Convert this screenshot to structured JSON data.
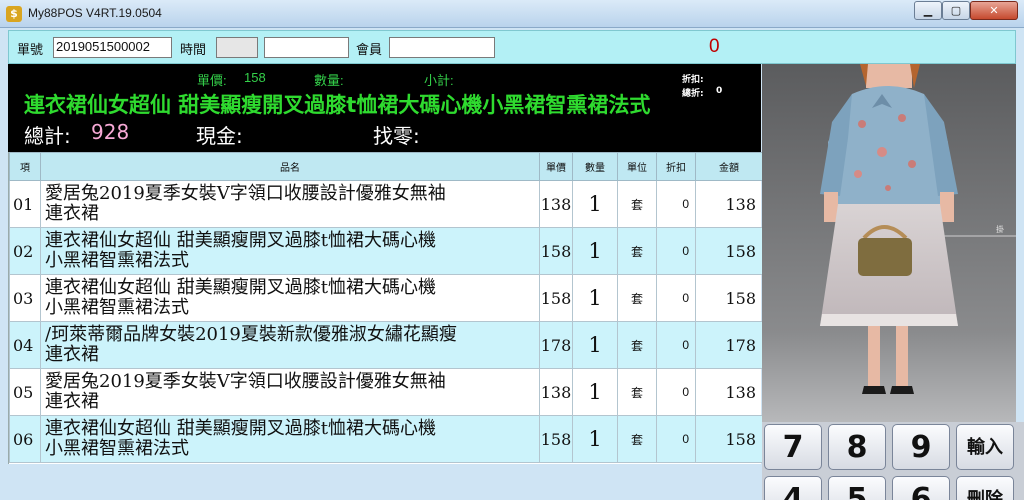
{
  "window": {
    "title": "My88POS V4RT.19.0504",
    "app_icon_glyph": "$",
    "minimize_glyph": "▁",
    "maximize_glyph": "▢",
    "close_glyph": "✕"
  },
  "header": {
    "order_label": "單號",
    "order_value": "2019051500002",
    "time_label": "時間",
    "time_value": "",
    "time_value2": "",
    "member_label": "會員",
    "member_value": "",
    "counter": "0"
  },
  "info": {
    "unit_price_label": "單價:",
    "unit_price_value": "158",
    "qty_label": "數量:",
    "subtotal_label": "小計:",
    "discount_label": "折扣:",
    "total_discount_label": "總折:",
    "total_discount_value": "0",
    "product_name": "連衣裙仙女超仙 甜美顯瘦開叉過膝t恤裙大碼心機小黑裙智熏裙法式",
    "total_label": "總計:",
    "total_value": "928",
    "cash_label": "現金:",
    "change_label": "找零:"
  },
  "table": {
    "columns": [
      "項",
      "品名",
      "單價",
      "數量",
      "單位",
      "折扣",
      "金額"
    ],
    "rows": [
      {
        "no": "01",
        "name": "愛居兔2019夏季女裝V字領口收腰設計優雅女無袖\n連衣裙",
        "price": "138",
        "qty": "1",
        "unit": "套",
        "discount": "0",
        "amount": "138"
      },
      {
        "no": "02",
        "name": "連衣裙仙女超仙 甜美顯瘦開叉過膝t恤裙大碼心機\n小黑裙智熏裙法式",
        "price": "158",
        "qty": "1",
        "unit": "套",
        "discount": "0",
        "amount": "158"
      },
      {
        "no": "03",
        "name": "連衣裙仙女超仙 甜美顯瘦開叉過膝t恤裙大碼心機\n小黑裙智熏裙法式",
        "price": "158",
        "qty": "1",
        "unit": "套",
        "discount": "0",
        "amount": "158"
      },
      {
        "no": "04",
        "name": "/珂萊蒂爾品牌女裝2019夏裝新款優雅淑女繡花顯瘦\n連衣裙",
        "price": "178",
        "qty": "1",
        "unit": "套",
        "discount": "0",
        "amount": "178"
      },
      {
        "no": "05",
        "name": "愛居兔2019夏季女裝V字領口收腰設計優雅女無袖\n連衣裙",
        "price": "138",
        "qty": "1",
        "unit": "套",
        "discount": "0",
        "amount": "138"
      },
      {
        "no": "06",
        "name": "連衣裙仙女超仙 甜美顯瘦開叉過膝t恤裙大碼心機\n小黑裙智熏裙法式",
        "price": "158",
        "qty": "1",
        "unit": "套",
        "discount": "0",
        "amount": "158"
      }
    ]
  },
  "photo": {
    "side_label": "掛"
  },
  "keypad": {
    "keys": [
      "7",
      "8",
      "9",
      "輸入",
      "4",
      "5",
      "6",
      "刪除"
    ]
  }
}
